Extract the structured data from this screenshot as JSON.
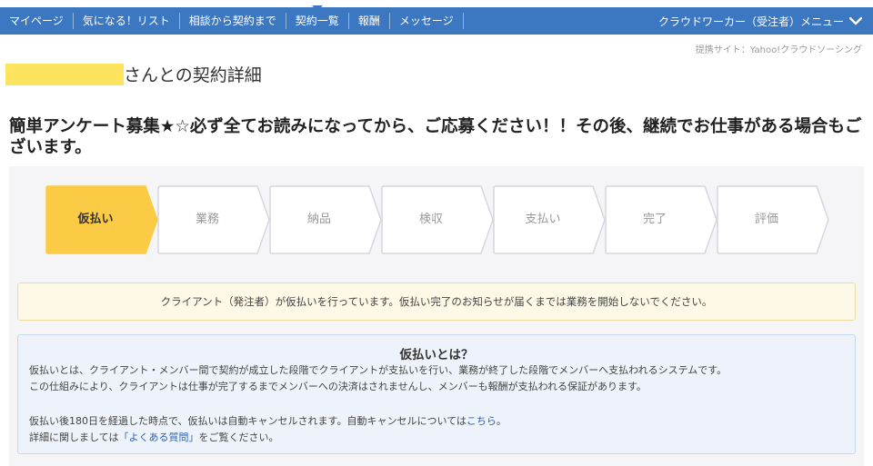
{
  "nav": {
    "items": [
      {
        "label": "マイページ"
      },
      {
        "label": "気になる！リスト"
      },
      {
        "label": "相談から契約まで"
      },
      {
        "label": "契約一覧"
      },
      {
        "label": "報酬"
      },
      {
        "label": "メッセージ"
      }
    ],
    "account_menu": "クラウドワーカー（受注者）メニュー"
  },
  "provider": "提携サイト：Yahoo!クラウドソーシング",
  "page_title": "さんとの契約詳細",
  "job_title": "簡単アンケート募集★☆必ず全てお読みになってから、ご応募ください！！その後、継続でお仕事がある場合もございます。",
  "steps": [
    {
      "label": "仮払い",
      "state": "active"
    },
    {
      "label": "業務",
      "state": "inactive"
    },
    {
      "label": "納品",
      "state": "inactive"
    },
    {
      "label": "検収",
      "state": "inactive"
    },
    {
      "label": "支払い",
      "state": "inactive"
    },
    {
      "label": "完了",
      "state": "inactive"
    },
    {
      "label": "評価",
      "state": "inactive"
    }
  ],
  "notice": "クライアント（発注者）が仮払いを行っています。仮払い完了のお知らせが届くまでは業務を開始しないでください。",
  "info": {
    "title": "仮払いとは？",
    "line1": "仮払いとは、クライアント・メンバー間で契約が成立した段階でクライアントが支払いを行い、業務が終了した段階でメンバーへ支払われるシステムです。",
    "line2": "この仕組みにより、クライアントは仕事が完了するまでメンバーへの決済はされませんし、メンバーも報酬が支払われる保証があります。",
    "line3_prefix": "仮払い後180日を経過した時点で、仮払いは自動キャンセルされます。自動キャンセルについては",
    "line3_link": "こちら",
    "line3_suffix": "。",
    "line4_prefix": "詳細に関しましては",
    "line4_link": "「よくある質問」",
    "line4_suffix": "をご覧ください。"
  },
  "colors": {
    "nav": "#3c78c2",
    "active_step": "#fbcb45",
    "link": "#2a62b4"
  }
}
